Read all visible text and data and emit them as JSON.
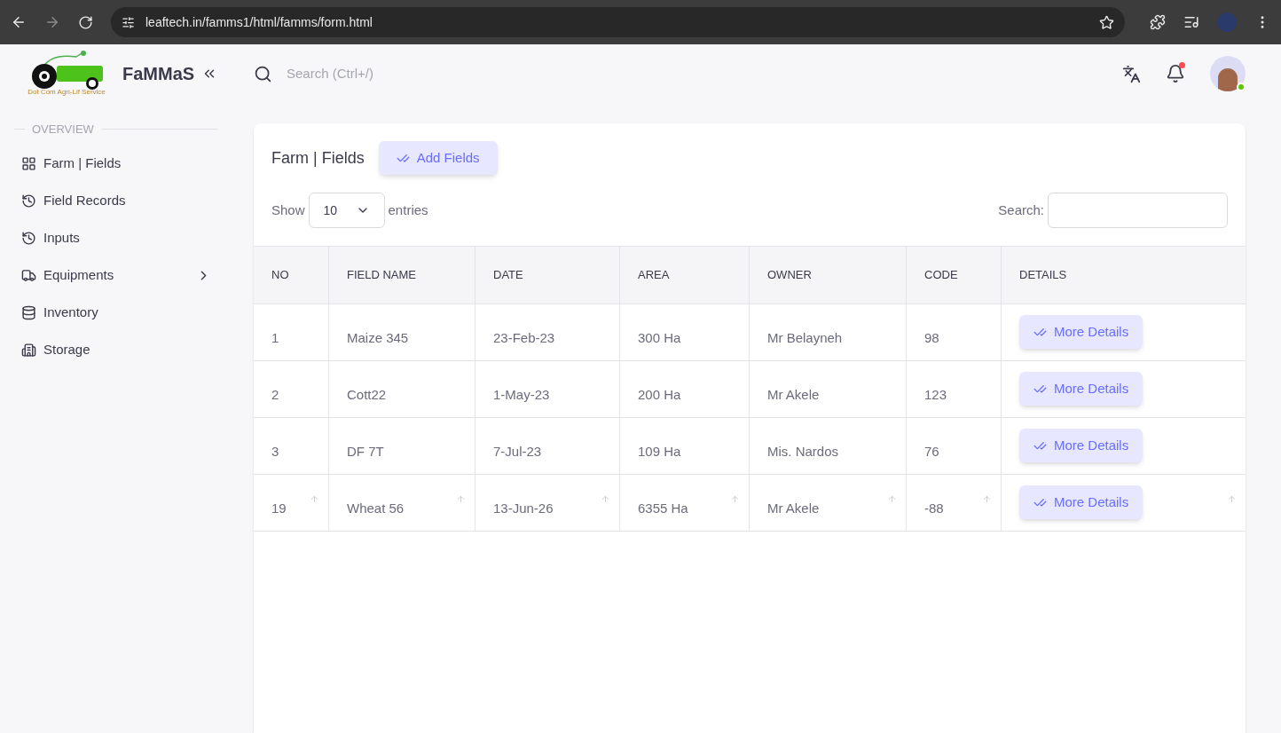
{
  "browser": {
    "url": "leaftech.in/famms1/html/famms/form.html"
  },
  "brand": {
    "name": "FaMMaS",
    "logo_caption": "Dot Com Agri-Lif Service"
  },
  "topbar": {
    "search_placeholder": "Search (Ctrl+/)",
    "notification_unread": true,
    "user_online": true
  },
  "sidebar": {
    "section": "OVERVIEW",
    "items": [
      {
        "label": "Farm | Fields",
        "kind": "grid",
        "has_submenu": false
      },
      {
        "label": "Field Records",
        "kind": "history",
        "has_submenu": false
      },
      {
        "label": "Inputs",
        "kind": "history",
        "has_submenu": false
      },
      {
        "label": "Equipments",
        "kind": "truck",
        "has_submenu": true
      },
      {
        "label": "Inventory",
        "kind": "database",
        "has_submenu": false
      },
      {
        "label": "Storage",
        "kind": "building",
        "has_submenu": false
      }
    ]
  },
  "card": {
    "title": "Farm | Fields",
    "add_button": "Add Fields",
    "show_label": "Show",
    "page_size": "10",
    "entries_label": "entries",
    "search_label": "Search:"
  },
  "table": {
    "columns": [
      "NO",
      "FIELD NAME",
      "DATE",
      "AREA",
      "OWNER",
      "CODE",
      "DETAILS"
    ],
    "rows": [
      {
        "cells": [
          "1",
          "Maize 345",
          "23-Feb-23",
          "300 Ha",
          "Mr Belayneh",
          "98"
        ],
        "button": "More Details",
        "hovered": false
      },
      {
        "cells": [
          "2",
          "Cott22",
          "1-May-23",
          "200 Ha",
          "Mr Akele",
          "123"
        ],
        "button": "More Details",
        "hovered": false
      },
      {
        "cells": [
          "3",
          "DF 7T",
          "7-Jul-23",
          "109 Ha",
          "Mis. Nardos",
          "76"
        ],
        "button": "More Details",
        "hovered": false
      },
      {
        "cells": [
          "19",
          "Wheat 56",
          "13-Jun-26",
          "6355 Ha",
          "Mr Akele",
          "-88"
        ],
        "button": "More Details",
        "hovered": true
      }
    ]
  }
}
